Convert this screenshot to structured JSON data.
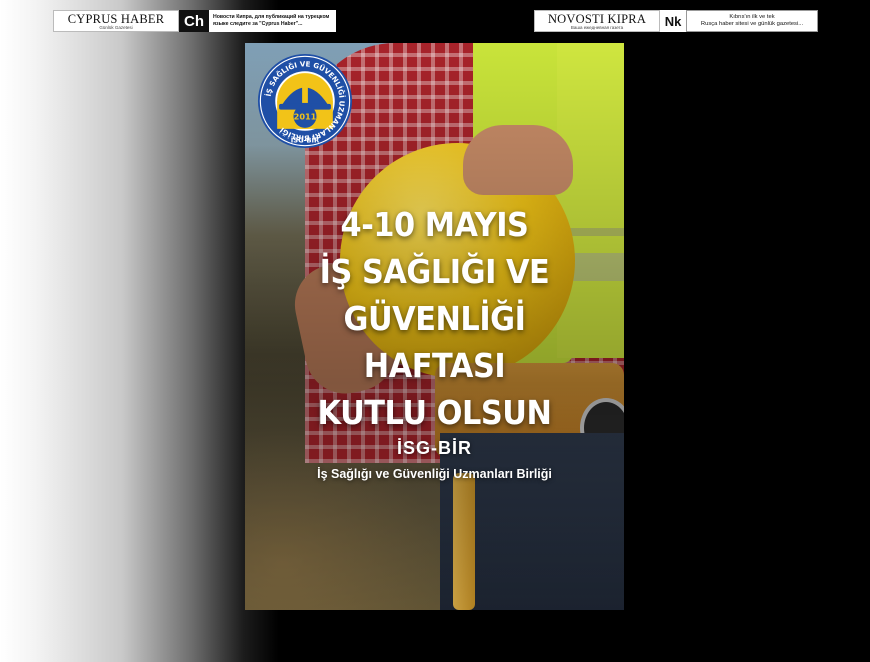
{
  "ads": {
    "left": {
      "brand_name": "CYPRUS HABER",
      "brand_sub": "Günlük Gazetesi",
      "logo_text": "Ch",
      "description": "Новости Кипра, для публикаций на турецком языке следите за \"Cyprus Haber\"..."
    },
    "right": {
      "brand_name": "NOVOSTI KIPRA",
      "brand_sub": "Ваша ежедневная газета",
      "logo_text": "Nk",
      "description_line1": "Kıbrıs'ın ilk ve tek",
      "description_line2": "Rusça haber sitesi ve günlük gazetesi..."
    }
  },
  "poster": {
    "seal": {
      "ring_text": "İŞ SAĞLIĞI VE GÜVENLİĞİ UZMANLARI BİRLİĞİ",
      "year": "2011",
      "bottom_text": "İSG-BİR"
    },
    "headline": [
      "4-10 MAYIS",
      "İŞ SAĞLIĞI VE",
      "GÜVENLİĞİ",
      "HAFTASI",
      "KUTLU OLSUN"
    ],
    "org_short": "İSG-BİR",
    "org_long": "İş Sağlığı ve Güvenliği Uzmanları Birliği"
  },
  "colors": {
    "seal_blue": "#1f4fa6",
    "seal_yellow": "#f2c318",
    "helmet_yellow": "#f5c817",
    "vest_green": "#c9e43a"
  }
}
